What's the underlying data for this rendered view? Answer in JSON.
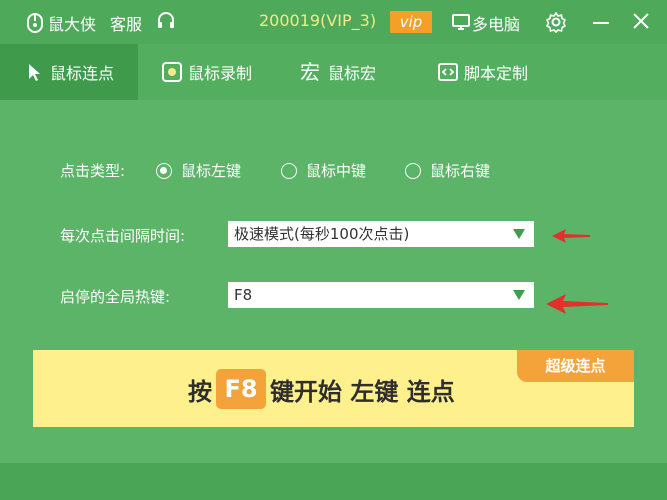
{
  "titlebar": {
    "app_name": "鼠大侠",
    "service": "客服",
    "user_id": "200019(VIP_3)",
    "vip_badge": "vip",
    "multi_pc": "多电脑"
  },
  "tabs": [
    {
      "label": "鼠标连点",
      "icon": "cursor-icon",
      "active": true
    },
    {
      "label": "鼠标录制",
      "icon": "record-icon",
      "active": false
    },
    {
      "label": "鼠标宏",
      "icon": "macro-icon",
      "active": false
    },
    {
      "label": "脚本定制",
      "icon": "script-icon",
      "active": false
    }
  ],
  "click_type": {
    "label": "点击类型:",
    "options": [
      "鼠标左键",
      "鼠标中键",
      "鼠标右键"
    ],
    "selected": "鼠标左键"
  },
  "interval": {
    "label": "每次点击间隔时间:",
    "value": "极速模式(每秒100次点击)"
  },
  "hotkey": {
    "label": "启停的全局热键:",
    "value": "F8"
  },
  "banner": {
    "corner_tag": "超级连点",
    "press": "按",
    "key": "F8",
    "rest": "键开始 左键 连点"
  },
  "colors": {
    "background": "#5cb468",
    "titlebar": "#4ea95a",
    "active_tab": "#3f9a4b",
    "accent_orange": "#f4a33a",
    "banner_yellow": "#fff08e",
    "arrow_red": "#e2302a",
    "user_id_yellow": "#f5e98a"
  }
}
